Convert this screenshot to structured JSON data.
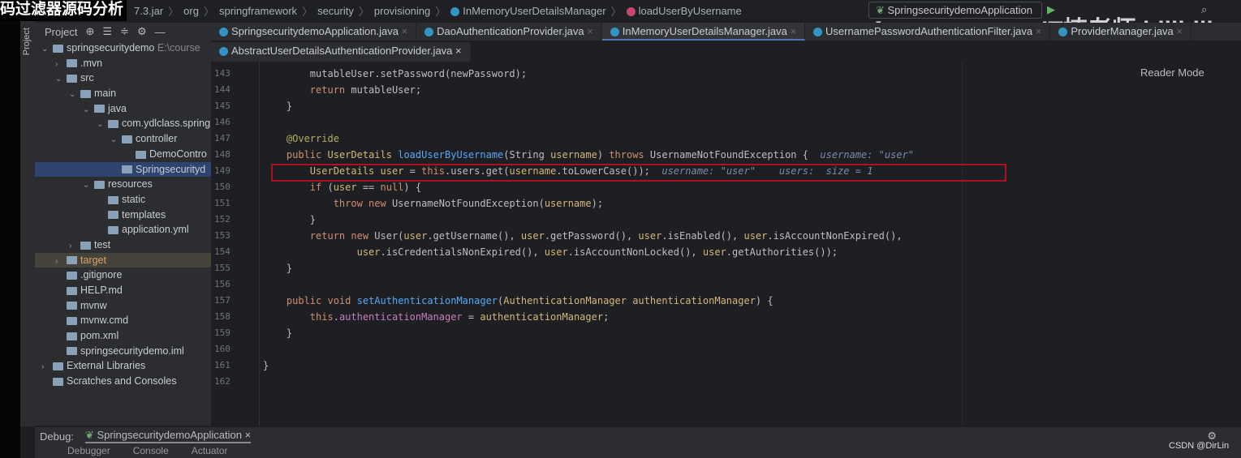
{
  "overlay_title": "码过滤器源码分析",
  "breadcrumb": [
    "7.3.jar",
    "org",
    "springframework",
    "security",
    "provisioning",
    "InMemoryUserDetailsManager",
    "loadUserByUsername"
  ],
  "run_config": "SpringsecuritydemoApplication",
  "stripe_label": "Project",
  "project_header": "Project",
  "tree": [
    {
      "label": "springsecuritydemo",
      "extra": "E:\\course",
      "indent": 0,
      "arrow": "v"
    },
    {
      "label": ".mvn",
      "indent": 1,
      "arrow": ">"
    },
    {
      "label": "src",
      "indent": 1,
      "arrow": "v"
    },
    {
      "label": "main",
      "indent": 2,
      "arrow": "v"
    },
    {
      "label": "java",
      "indent": 3,
      "arrow": "v"
    },
    {
      "label": "com.ydlclass.spring",
      "indent": 4,
      "arrow": "v"
    },
    {
      "label": "controller",
      "indent": 5,
      "arrow": "v"
    },
    {
      "label": "DemoContro",
      "indent": 6,
      "arrow": ""
    },
    {
      "label": "Springsecurityd",
      "indent": 5,
      "arrow": "",
      "selected": true
    },
    {
      "label": "resources",
      "indent": 3,
      "arrow": "v"
    },
    {
      "label": "static",
      "indent": 4,
      "arrow": ""
    },
    {
      "label": "templates",
      "indent": 4,
      "arrow": ""
    },
    {
      "label": "application.yml",
      "indent": 4,
      "arrow": ""
    },
    {
      "label": "test",
      "indent": 2,
      "arrow": ">"
    },
    {
      "label": "target",
      "indent": 1,
      "arrow": ">",
      "target": true
    },
    {
      "label": ".gitignore",
      "indent": 1,
      "arrow": ""
    },
    {
      "label": "HELP.md",
      "indent": 1,
      "arrow": ""
    },
    {
      "label": "mvnw",
      "indent": 1,
      "arrow": ""
    },
    {
      "label": "mvnw.cmd",
      "indent": 1,
      "arrow": ""
    },
    {
      "label": "pom.xml",
      "indent": 1,
      "arrow": ""
    },
    {
      "label": "springsecuritydemo.iml",
      "indent": 1,
      "arrow": ""
    },
    {
      "label": "External Libraries",
      "indent": 0,
      "arrow": ">"
    },
    {
      "label": "Scratches and Consoles",
      "indent": 0,
      "arrow": ""
    }
  ],
  "tabs": [
    "SpringsecuritydemoApplication.java",
    "DaoAuthenticationProvider.java",
    "InMemoryUserDetailsManager.java",
    "UsernamePasswordAuthenticationFilter.java",
    "ProviderManager.java"
  ],
  "active_tab": 2,
  "tab_row2": "AbstractUserDetailsAuthenticationProvider.java",
  "reader_mode": "Reader Mode",
  "code_lines": [
    {
      "n": "143",
      "html": "        mutableUser.setPassword(newPassword);"
    },
    {
      "n": "144",
      "html": "        <span class='kw'>return</span> mutableUser;"
    },
    {
      "n": "145",
      "html": "    }"
    },
    {
      "n": "146",
      "html": ""
    },
    {
      "n": "147",
      "html": "    <span class='an'>@Override</span>"
    },
    {
      "n": "148",
      "html": "    <span class='kw'>public</span> <span class='pm'>UserDetails</span> <span class='fn'>loadUserByUsername</span>(String <span class='pm'>username</span>) <span class='kw'>throws</span> UsernameNotFoundException {  <span class='dbg'>username: \"user\"</span>"
    },
    {
      "n": "149",
      "html": "        <span class='pm'>UserDetails</span> <span class='pm'>user</span> = <span class='kw'>this</span>.users.get(<span class='pm'>username</span>.toLowerCase());  <span class='dbg'>username: \"user\"    users:  size = 1</span>",
      "highlight": true
    },
    {
      "n": "150",
      "html": "        <span class='kw'>if</span> (<span class='pm'>user</span> == <span class='kw'>null</span>) {"
    },
    {
      "n": "151",
      "html": "            <span class='kw'>throw new</span> UsernameNotFoundException(<span class='pm'>username</span>);"
    },
    {
      "n": "152",
      "html": "        }"
    },
    {
      "n": "153",
      "html": "        <span class='kw'>return new</span> User(<span class='pm'>user</span>.getUsername(), <span class='pm'>user</span>.getPassword(), <span class='pm'>user</span>.isEnabled(), <span class='pm'>user</span>.isAccountNonExpired(),"
    },
    {
      "n": "154",
      "html": "                <span class='pm'>user</span>.isCredentialsNonExpired(), <span class='pm'>user</span>.isAccountNonLocked(), <span class='pm'>user</span>.getAuthorities());"
    },
    {
      "n": "155",
      "html": "    }"
    },
    {
      "n": "156",
      "html": ""
    },
    {
      "n": "157",
      "html": "    <span class='kw'>public void</span> <span class='fn'>setAuthenticationManager</span>(<span class='pm'>AuthenticationManager</span> <span class='pm'>authenticationManager</span>) {"
    },
    {
      "n": "158",
      "html": "        <span class='kw'>this</span>.<span class='fd'>authenticationManager</span> = <span class='pm'>authenticationManager</span>;"
    },
    {
      "n": "159",
      "html": "    }"
    },
    {
      "n": "160",
      "html": ""
    },
    {
      "n": "161",
      "html": "}"
    },
    {
      "n": "162",
      "html": ""
    }
  ],
  "debug": {
    "label": "Debug:",
    "session": "SpringsecuritydemoApplication",
    "tabs": [
      "Debugger",
      "Console",
      "Actuator"
    ]
  },
  "watermark": "IT楠老师 bilibili",
  "credit": "CSDN @DirLin"
}
